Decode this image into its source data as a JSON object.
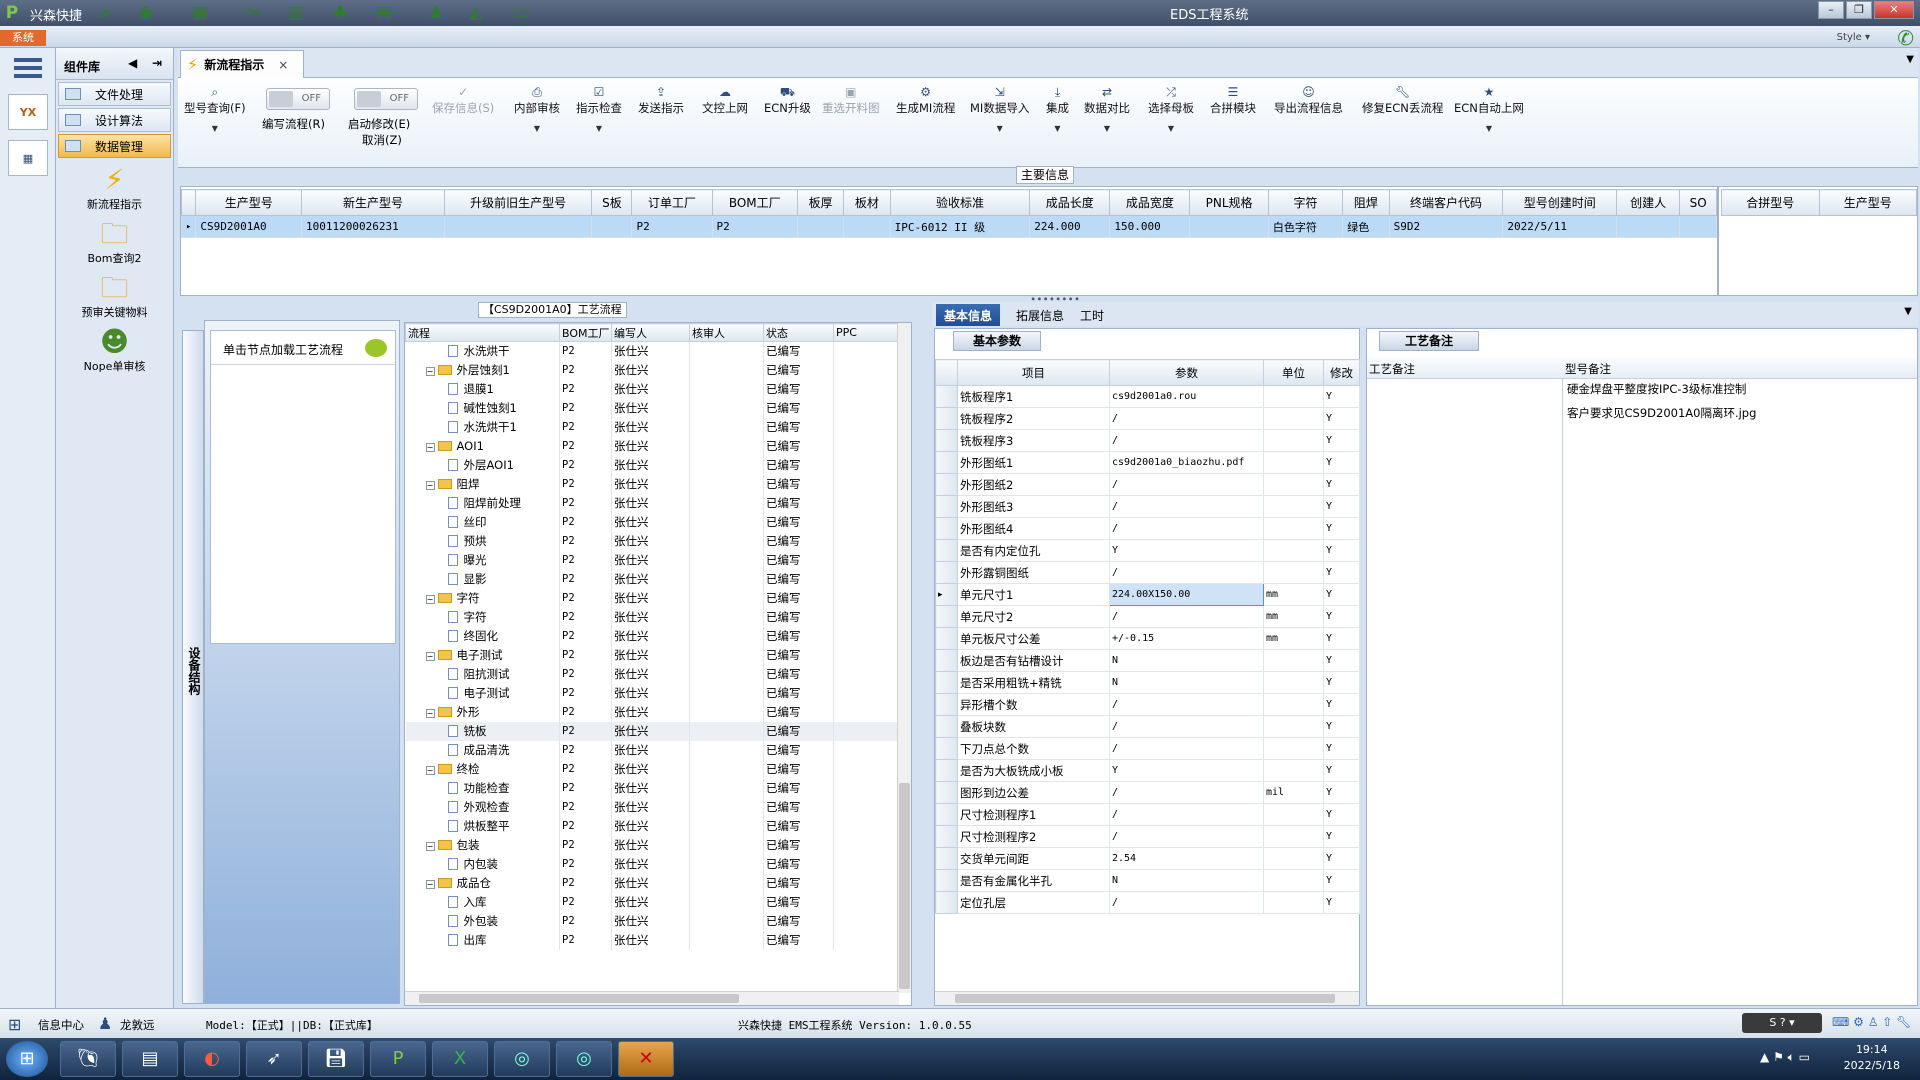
{
  "titlebar": {
    "app_title": "兴森快捷",
    "window_title": "EDS工程系统"
  },
  "menustrip": {
    "system": "系统",
    "style": "Style"
  },
  "component_panel": {
    "title": "组件库",
    "items": [
      {
        "label": "文件处理"
      },
      {
        "label": "设计算法"
      },
      {
        "label": "数据管理"
      }
    ],
    "big_items": [
      {
        "label": "新流程指示",
        "icon": "lightning-icon"
      },
      {
        "label": "Bom查询2",
        "icon": "folder-icon"
      },
      {
        "label": "预审关键物料",
        "icon": "folder-icon"
      },
      {
        "label": "Nope单审核",
        "icon": "user-icon"
      }
    ]
  },
  "tab": {
    "label": "新流程指示",
    "close": "×"
  },
  "toolbar": {
    "buttons": [
      {
        "label": "型号查询(F)",
        "icon": "search-icon",
        "dd": true
      },
      {
        "label": "保存信息(S)",
        "icon": "check-icon",
        "disabled": true
      },
      {
        "label": "内部审核",
        "icon": "printer-icon",
        "dd": true
      },
      {
        "label": "指示检查",
        "icon": "checkbox-icon",
        "dd": true
      },
      {
        "label": "发送指示",
        "icon": "upload-icon"
      },
      {
        "label": "文控上网",
        "icon": "cloud-icon"
      },
      {
        "label": "ECN升级",
        "icon": "car-icon"
      },
      {
        "label": "重选开料图",
        "icon": "image-icon",
        "disabled": true
      },
      {
        "label": "生成MI流程",
        "icon": "gears-icon"
      },
      {
        "label": "MI数据导入",
        "icon": "import-icon",
        "dd": true
      },
      {
        "label": "集成",
        "icon": "download-icon",
        "dd": true
      },
      {
        "label": "数据对比",
        "icon": "compare-icon",
        "dd": true
      },
      {
        "label": "选择母板",
        "icon": "shuffle-icon",
        "dd": true
      },
      {
        "label": "合拼模块",
        "icon": "list-icon"
      },
      {
        "label": "导出流程信息",
        "icon": "smile-icon"
      },
      {
        "label": "修复ECN丢流程",
        "icon": "wrench-icon"
      },
      {
        "label": "ECN自动上网",
        "icon": "star-icon",
        "dd": true
      }
    ],
    "toggle1": {
      "state": "OFF",
      "label": "编写流程(R)"
    },
    "toggle2": {
      "state": "OFF",
      "label": "启动修改(E)",
      "sublabel": "取消(Z)"
    }
  },
  "main_info": {
    "legend": "主要信息",
    "columns": [
      "生产型号",
      "新生产型号",
      "升级前旧生产型号",
      "S板",
      "订单工厂",
      "BOM工厂",
      "板厚",
      "板材",
      "验收标准",
      "成品长度",
      "成品宽度",
      "PNL规格",
      "字符",
      "阻焊",
      "终端客户代码",
      "型号创建时间",
      "创建人",
      "SO"
    ],
    "rows": [
      [
        "CS9D2001A0",
        "10011200026231",
        "",
        "",
        "P2",
        "P2",
        "",
        "",
        "IPC-6012 II 级",
        "224.000",
        "150.000",
        "",
        "白色字符",
        "绿色",
        "S9D2",
        "2022/5/11",
        "",
        ""
      ]
    ],
    "right_columns": [
      "合拼型号",
      "生产型号"
    ]
  },
  "tree_panel": {
    "legend": "【CS9D2001A0】工艺流程",
    "side_tab": "设备结构",
    "side_card_label": "单击节点加载工艺流程",
    "columns": [
      "流程",
      "BOM工厂",
      "编写人",
      "核审人",
      "状态",
      "PPC"
    ],
    "rows": [
      {
        "name": "水洗烘干",
        "level": 2,
        "type": "doc",
        "bom": "P2",
        "author": "张仕兴",
        "status": "已编写"
      },
      {
        "name": "外层蚀刻1",
        "level": 1,
        "type": "folder",
        "bom": "P2",
        "author": "张仕兴",
        "status": "已编写"
      },
      {
        "name": "退膜1",
        "level": 2,
        "type": "doc",
        "bom": "P2",
        "author": "张仕兴",
        "status": "已编写"
      },
      {
        "name": "碱性蚀刻1",
        "level": 2,
        "type": "doc",
        "bom": "P2",
        "author": "张仕兴",
        "status": "已编写"
      },
      {
        "name": "水洗烘干1",
        "level": 2,
        "type": "doc",
        "bom": "P2",
        "author": "张仕兴",
        "status": "已编写"
      },
      {
        "name": "AOI1",
        "level": 1,
        "type": "folder",
        "bom": "P2",
        "author": "张仕兴",
        "status": "已编写"
      },
      {
        "name": "外层AOI1",
        "level": 2,
        "type": "doc",
        "bom": "P2",
        "author": "张仕兴",
        "status": "已编写"
      },
      {
        "name": "阻焊",
        "level": 1,
        "type": "folder",
        "bom": "P2",
        "author": "张仕兴",
        "status": "已编写"
      },
      {
        "name": "阻焊前处理",
        "level": 2,
        "type": "doc",
        "bom": "P2",
        "author": "张仕兴",
        "status": "已编写"
      },
      {
        "name": "丝印",
        "level": 2,
        "type": "doc",
        "bom": "P2",
        "author": "张仕兴",
        "status": "已编写"
      },
      {
        "name": "预烘",
        "level": 2,
        "type": "doc",
        "bom": "P2",
        "author": "张仕兴",
        "status": "已编写"
      },
      {
        "name": "曝光",
        "level": 2,
        "type": "doc",
        "bom": "P2",
        "author": "张仕兴",
        "status": "已编写"
      },
      {
        "name": "显影",
        "level": 2,
        "type": "doc",
        "bom": "P2",
        "author": "张仕兴",
        "status": "已编写"
      },
      {
        "name": "字符",
        "level": 1,
        "type": "folder",
        "bom": "P2",
        "author": "张仕兴",
        "status": "已编写"
      },
      {
        "name": "字符",
        "level": 2,
        "type": "doc",
        "bom": "P2",
        "author": "张仕兴",
        "status": "已编写"
      },
      {
        "name": "终固化",
        "level": 2,
        "type": "doc",
        "bom": "P2",
        "author": "张仕兴",
        "status": "已编写"
      },
      {
        "name": "电子测试",
        "level": 1,
        "type": "folder",
        "bom": "P2",
        "author": "张仕兴",
        "status": "已编写"
      },
      {
        "name": "阻抗测试",
        "level": 2,
        "type": "doc",
        "bom": "P2",
        "author": "张仕兴",
        "status": "已编写"
      },
      {
        "name": "电子测试",
        "level": 2,
        "type": "doc",
        "bom": "P2",
        "author": "张仕兴",
        "status": "已编写"
      },
      {
        "name": "外形",
        "level": 1,
        "type": "folder",
        "bom": "P2",
        "author": "张仕兴",
        "status": "已编写"
      },
      {
        "name": "铣板",
        "level": 2,
        "type": "doc",
        "bom": "P2",
        "author": "张仕兴",
        "status": "已编写",
        "selected": true
      },
      {
        "name": "成品清洗",
        "level": 2,
        "type": "doc",
        "bom": "P2",
        "author": "张仕兴",
        "status": "已编写"
      },
      {
        "name": "终检",
        "level": 1,
        "type": "folder",
        "bom": "P2",
        "author": "张仕兴",
        "status": "已编写"
      },
      {
        "name": "功能检查",
        "level": 2,
        "type": "doc",
        "bom": "P2",
        "author": "张仕兴",
        "status": "已编写"
      },
      {
        "name": "外观检查",
        "level": 2,
        "type": "doc",
        "bom": "P2",
        "author": "张仕兴",
        "status": "已编写"
      },
      {
        "name": "烘板整平",
        "level": 2,
        "type": "doc",
        "bom": "P2",
        "author": "张仕兴",
        "status": "已编写"
      },
      {
        "name": "包装",
        "level": 1,
        "type": "folder",
        "bom": "P2",
        "author": "张仕兴",
        "status": "已编写"
      },
      {
        "name": "内包装",
        "level": 2,
        "type": "doc",
        "bom": "P2",
        "author": "张仕兴",
        "status": "已编写"
      },
      {
        "name": "成品仓",
        "level": 1,
        "type": "folder",
        "bom": "P2",
        "author": "张仕兴",
        "status": "已编写"
      },
      {
        "name": "入库",
        "level": 2,
        "type": "doc",
        "bom": "P2",
        "author": "张仕兴",
        "status": "已编写"
      },
      {
        "name": "外包装",
        "level": 2,
        "type": "doc",
        "bom": "P2",
        "author": "张仕兴",
        "status": "已编写"
      },
      {
        "name": "出库",
        "level": 2,
        "type": "doc",
        "bom": "P2",
        "author": "张仕兴",
        "status": "已编写"
      }
    ]
  },
  "right_tabs": [
    "基本信息",
    "拓展信息",
    "工时"
  ],
  "basic_params": {
    "caption": "基本参数",
    "columns": [
      "项目",
      "参数",
      "单位",
      "修改"
    ],
    "rows": [
      [
        "铣板程序1",
        "cs9d2001a0.rou",
        "",
        "Y"
      ],
      [
        "铣板程序2",
        "/",
        "",
        "Y"
      ],
      [
        "铣板程序3",
        "/",
        "",
        "Y"
      ],
      [
        "外形图纸1",
        "cs9d2001a0_biaozhu.pdf",
        "",
        "Y"
      ],
      [
        "外形图纸2",
        "/",
        "",
        "Y"
      ],
      [
        "外形图纸3",
        "/",
        "",
        "Y"
      ],
      [
        "外形图纸4",
        "/",
        "",
        "Y"
      ],
      [
        "是否有内定位孔",
        "Y",
        "",
        "Y"
      ],
      [
        "外形露铜图纸",
        "/",
        "",
        "Y"
      ],
      [
        "单元尺寸1",
        "224.00X150.00",
        "mm",
        "Y"
      ],
      [
        "单元尺寸2",
        "/",
        "mm",
        "Y"
      ],
      [
        "单元板尺寸公差",
        "+/-0.15",
        "mm",
        "Y"
      ],
      [
        "板边是否有钻槽设计",
        "N",
        "",
        "Y"
      ],
      [
        "是否采用粗铣+精铣",
        "N",
        "",
        "Y"
      ],
      [
        "异形槽个数",
        "/",
        "",
        "Y"
      ],
      [
        "叠板块数",
        "/",
        "",
        "Y"
      ],
      [
        "下刀点总个数",
        "/",
        "",
        "Y"
      ],
      [
        "是否为大板铣成小板",
        "Y",
        "",
        "Y"
      ],
      [
        "图形到边公差",
        "/",
        "mil",
        "Y"
      ],
      [
        "尺寸检测程序1",
        "/",
        "",
        "Y"
      ],
      [
        "尺寸检测程序2",
        "/",
        "",
        "Y"
      ],
      [
        "交货单元间距",
        "2.54",
        "",
        "Y"
      ],
      [
        "是否有金属化半孔",
        "N",
        "",
        "Y"
      ],
      [
        "定位孔层",
        "/",
        "",
        "Y"
      ]
    ]
  },
  "process_notes": {
    "caption": "工艺备注",
    "columns": [
      "工艺备注",
      "型号备注"
    ],
    "model_notes": [
      "硬金焊盘平整度按IPC-3级标准控制",
      "客户要求见CS9D2001A0隔离环.jpg"
    ]
  },
  "statusbar": {
    "info_center": "信息中心",
    "user": "龙敦远",
    "model_db": "Model:【正式】||DB:【正式库】",
    "version": "兴森快捷 EMS工程系统 Version: 1.0.0.55"
  },
  "taskbar": {
    "time": "19:14",
    "date": "2022/5/18"
  }
}
